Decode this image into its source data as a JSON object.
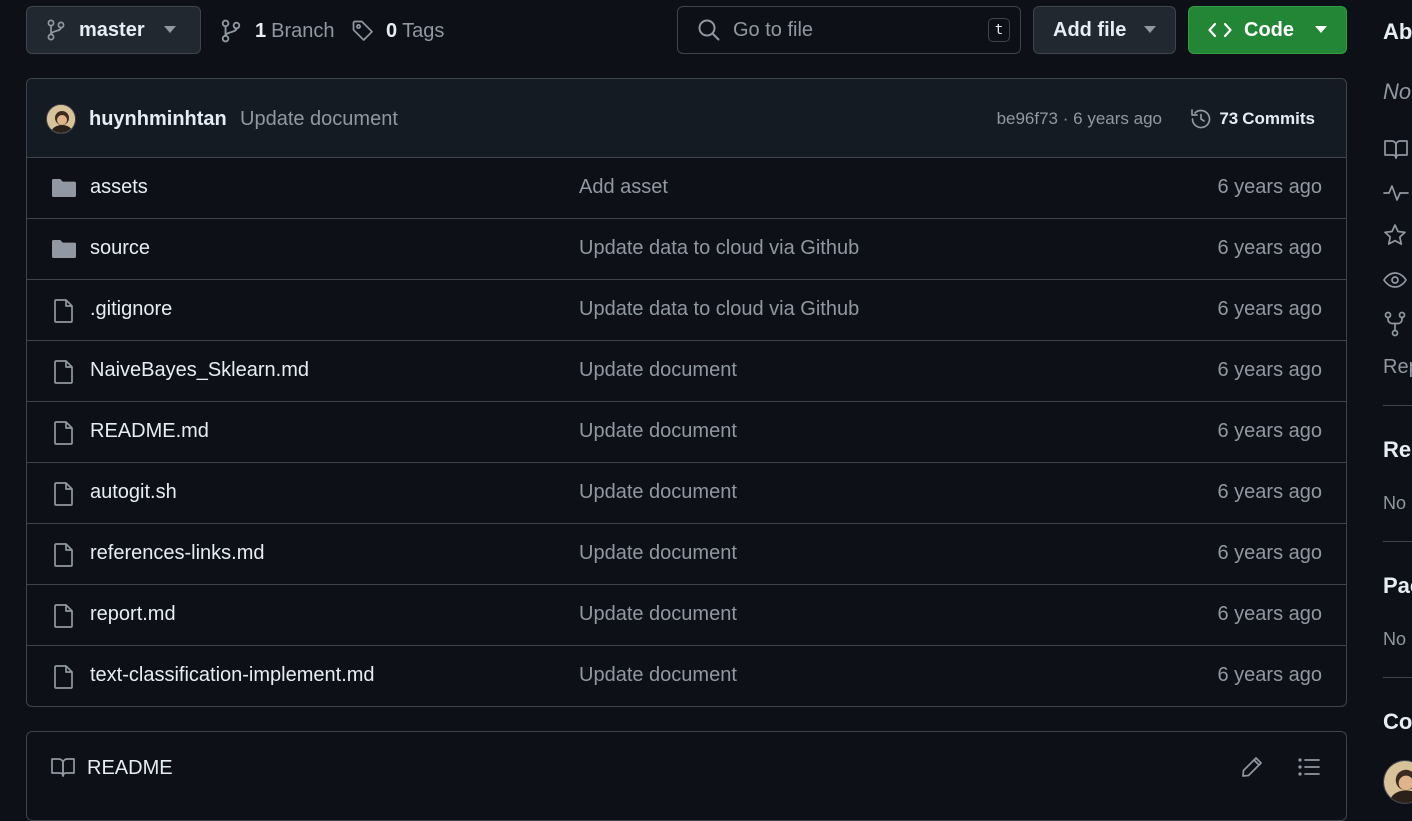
{
  "toolbar": {
    "branch_name": "master",
    "branches_count": "1",
    "branches_label": "Branch",
    "tags_count": "0",
    "tags_label": "Tags",
    "search_placeholder": "Go to file",
    "search_shortcut": "t",
    "add_file_label": "Add file",
    "code_label": "Code"
  },
  "latest_commit": {
    "author": "huynhminhtan",
    "message": "Update document",
    "hash": "be96f73",
    "separator": "·",
    "age": "6 years ago",
    "commits_count": "73",
    "commits_label": "Commits"
  },
  "files": [
    {
      "type": "folder",
      "name": "assets",
      "message": "Add asset",
      "age": "6 years ago"
    },
    {
      "type": "folder",
      "name": "source",
      "message": "Update data to cloud via Github",
      "age": "6 years ago"
    },
    {
      "type": "file",
      "name": ".gitignore",
      "message": "Update data to cloud via Github",
      "age": "6 years ago"
    },
    {
      "type": "file",
      "name": "NaiveBayes_Sklearn.md",
      "message": "Update document",
      "age": "6 years ago"
    },
    {
      "type": "file",
      "name": "README.md",
      "message": "Update document",
      "age": "6 years ago"
    },
    {
      "type": "file",
      "name": "autogit.sh",
      "message": "Update document",
      "age": "6 years ago"
    },
    {
      "type": "file",
      "name": "references-links.md",
      "message": "Update document",
      "age": "6 years ago"
    },
    {
      "type": "file",
      "name": "report.md",
      "message": "Update document",
      "age": "6 years ago"
    },
    {
      "type": "file",
      "name": "text-classification-implement.md",
      "message": "Update document",
      "age": "6 years ago"
    }
  ],
  "readme": {
    "title": "README"
  },
  "sidebar": {
    "about_heading": "Ab",
    "about_text": "No",
    "repo_text": "Rep",
    "releases_heading": "Rel",
    "releases_text": "No",
    "packages_heading": "Pac",
    "packages_text": "No",
    "contributors_heading": "Co"
  },
  "colors": {
    "background": "#0d1117",
    "border": "#3d444d",
    "muted_text": "#9198a1",
    "code_button": "#238636",
    "header_bg": "#151b23"
  }
}
